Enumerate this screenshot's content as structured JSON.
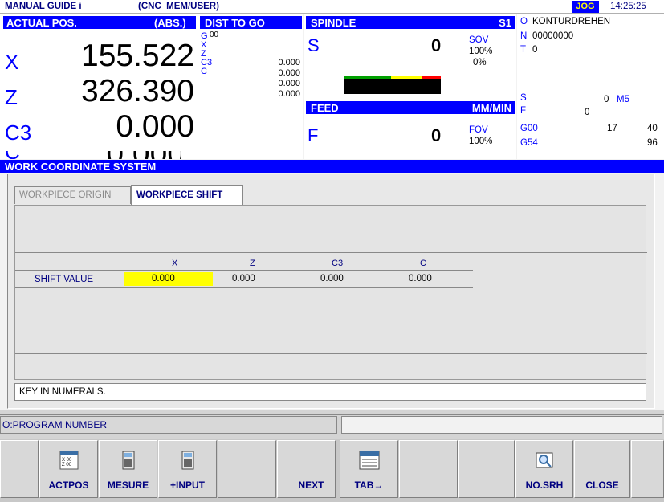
{
  "header": {
    "app": "MANUAL GUIDE i",
    "program": "(CNC_MEM/USER)",
    "mode": "JOG",
    "time": "14:25:25"
  },
  "actual": {
    "title": "ACTUAL POS.",
    "mode": "(ABS.)",
    "axes": [
      {
        "name": "X",
        "value": "155.522"
      },
      {
        "name": "Z",
        "value": "326.390"
      },
      {
        "name": "C3",
        "value": "0.000"
      }
    ]
  },
  "dist": {
    "title": "DIST TO GO",
    "g": "G",
    "g_val": "00",
    "axes": [
      "X",
      "Z",
      "C3",
      "C"
    ],
    "values": [
      "0.000",
      "0.000",
      "0.000",
      "0.000"
    ]
  },
  "spindle": {
    "title": "SPINDLE",
    "s1": "S1",
    "s_label": "S",
    "s_value": "0",
    "sov_label": "SOV",
    "sov_value": "100%",
    "load_value": "0%"
  },
  "feed": {
    "title": "FEED",
    "unit": "MM/MIN",
    "f_label": "F",
    "f_value": "0",
    "fov_label": "FOV",
    "fov_value": "100%"
  },
  "info": {
    "o_label": "O",
    "o_value": "KONTURDREHEN",
    "n_label": "N",
    "n_value": "00000000",
    "t_label": "T",
    "t_value": "0",
    "s_label": "S",
    "s_value": "0",
    "m_value": "M5",
    "f_label": "F",
    "f_value": "0",
    "g1_code": "G00",
    "g1_a": "17",
    "g1_b": "40",
    "g2_code": "G54",
    "g2_b": "96"
  },
  "window": {
    "title": "WORK COORDINATE SYSTEM",
    "tabs": [
      "WORKPIECE ORIGIN",
      "WORKPIECE SHIFT"
    ],
    "table": {
      "columns": [
        "X",
        "Z",
        "C3",
        "C"
      ],
      "row_label": "SHIFT VALUE",
      "values": [
        "0.000",
        "0.000",
        "0.000",
        "0.000"
      ]
    },
    "message": "KEY IN NUMERALS."
  },
  "input_label": "O:PROGRAM NUMBER",
  "softkeys": [
    "ACTPOS",
    "MESURE",
    "+INPUT",
    "NEXT",
    "TAB→",
    "NO.SRH",
    "CLOSE"
  ],
  "colors": {
    "accent": "#0000ff",
    "highlight": "#ffff00",
    "label": "#000080"
  }
}
